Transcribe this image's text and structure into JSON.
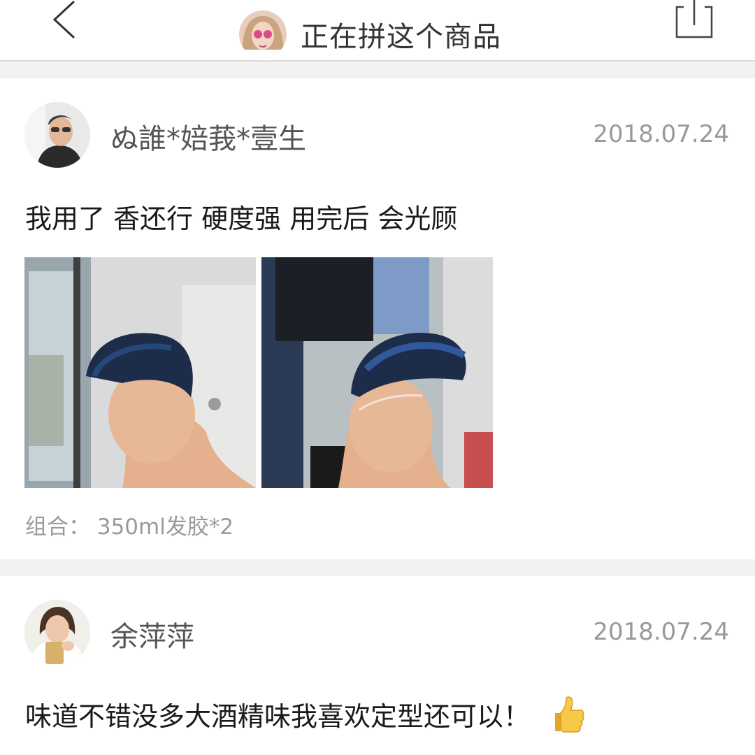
{
  "header": {
    "title": "正在拼这个商品",
    "back_icon": "chevron-left-icon",
    "share_icon": "share-icon"
  },
  "reviews": [
    {
      "username": "ぬ誰*婄莪*壹生",
      "date": "2018.07.24",
      "text": "我用了 香还行 硬度强 用完后 会光顾",
      "photo_count": 2,
      "combo": "组合：  350ml发胶*2"
    },
    {
      "username": "余萍萍",
      "date": "2018.07.24",
      "text": "味道不错没多大酒精味我喜欢定型还可以！",
      "emoji": "thumbs-up-icon"
    }
  ],
  "colors": {
    "background": "#ffffff",
    "separator": "#f2f2f2",
    "muted_text": "#999999",
    "primary_text": "#1a1a1a"
  }
}
